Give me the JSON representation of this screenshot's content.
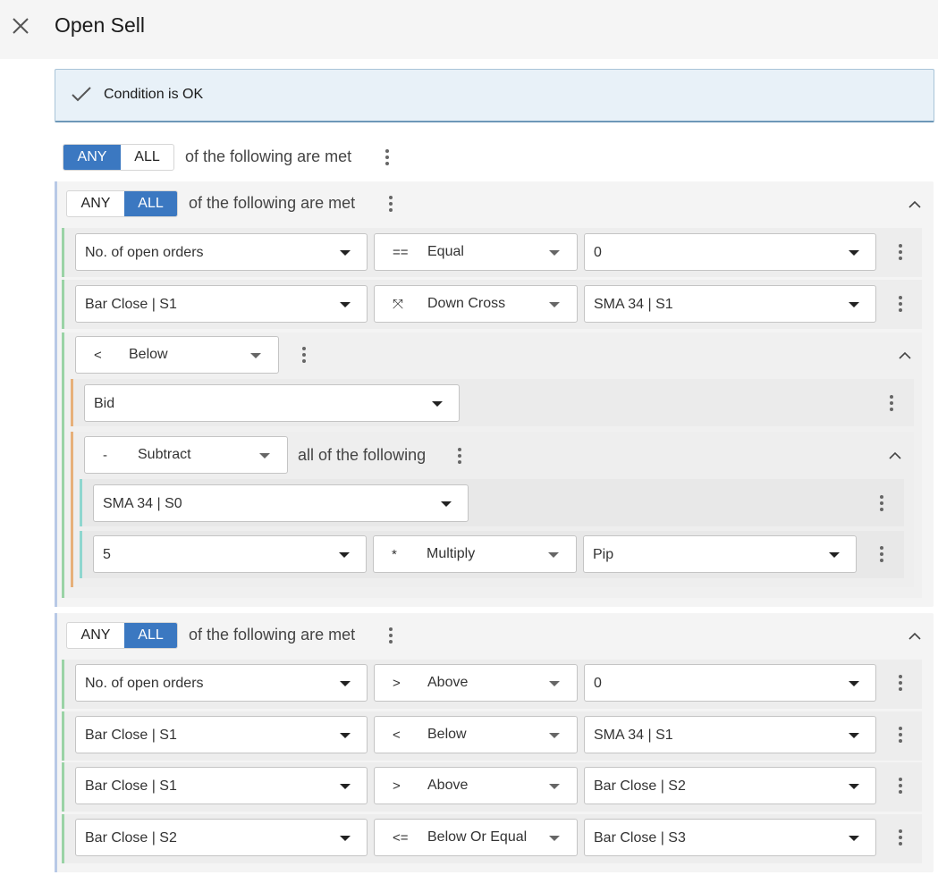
{
  "header": {
    "title": "Open Sell",
    "close_icon": "close-icon"
  },
  "status": {
    "message": "Condition is OK",
    "icon": "check-icon"
  },
  "root": {
    "any": "ANY",
    "all": "ALL",
    "selected": "ANY",
    "suffix": "of the following are met"
  },
  "group1": {
    "any": "ANY",
    "all": "ALL",
    "selected": "ALL",
    "suffix": "of the following are met",
    "rows": [
      {
        "left": "No. of open orders",
        "op_symbol": "==",
        "op_label": "Equal",
        "right": "0"
      },
      {
        "left": "Bar Close | S1",
        "op_symbol": "⤧",
        "op_label": "Down Cross",
        "right": "SMA 34 | S1"
      }
    ],
    "below": {
      "op_symbol": "<",
      "op_label": "Below",
      "value": "Bid",
      "subtract": {
        "op_symbol": "-",
        "op_label": "Subtract",
        "suffix": "all of the following",
        "value": "SMA 34 | S0",
        "multiply": {
          "left": "5",
          "op_symbol": "*",
          "op_label": "Multiply",
          "right": "Pip"
        }
      }
    }
  },
  "group2": {
    "any": "ANY",
    "all": "ALL",
    "selected": "ALL",
    "suffix": "of the following are met",
    "rows": [
      {
        "left": "No. of open orders",
        "op_symbol": ">",
        "op_label": "Above",
        "right": "0"
      },
      {
        "left": "Bar Close | S1",
        "op_symbol": "<",
        "op_label": "Below",
        "right": "SMA 34 | S1"
      },
      {
        "left": "Bar Close | S1",
        "op_symbol": ">",
        "op_label": "Above",
        "right": "Bar Close | S2"
      },
      {
        "left": "Bar Close | S2",
        "op_symbol": "<=",
        "op_label": "Below Or Equal",
        "right": "Bar Close | S3"
      }
    ]
  },
  "colors": {
    "accent": "#3b78c1",
    "green_bar": "#9ad3a6",
    "orange_bar": "#e7b07a",
    "teal_bar": "#8fd6cf",
    "blue_bar": "#b8c9e6"
  }
}
